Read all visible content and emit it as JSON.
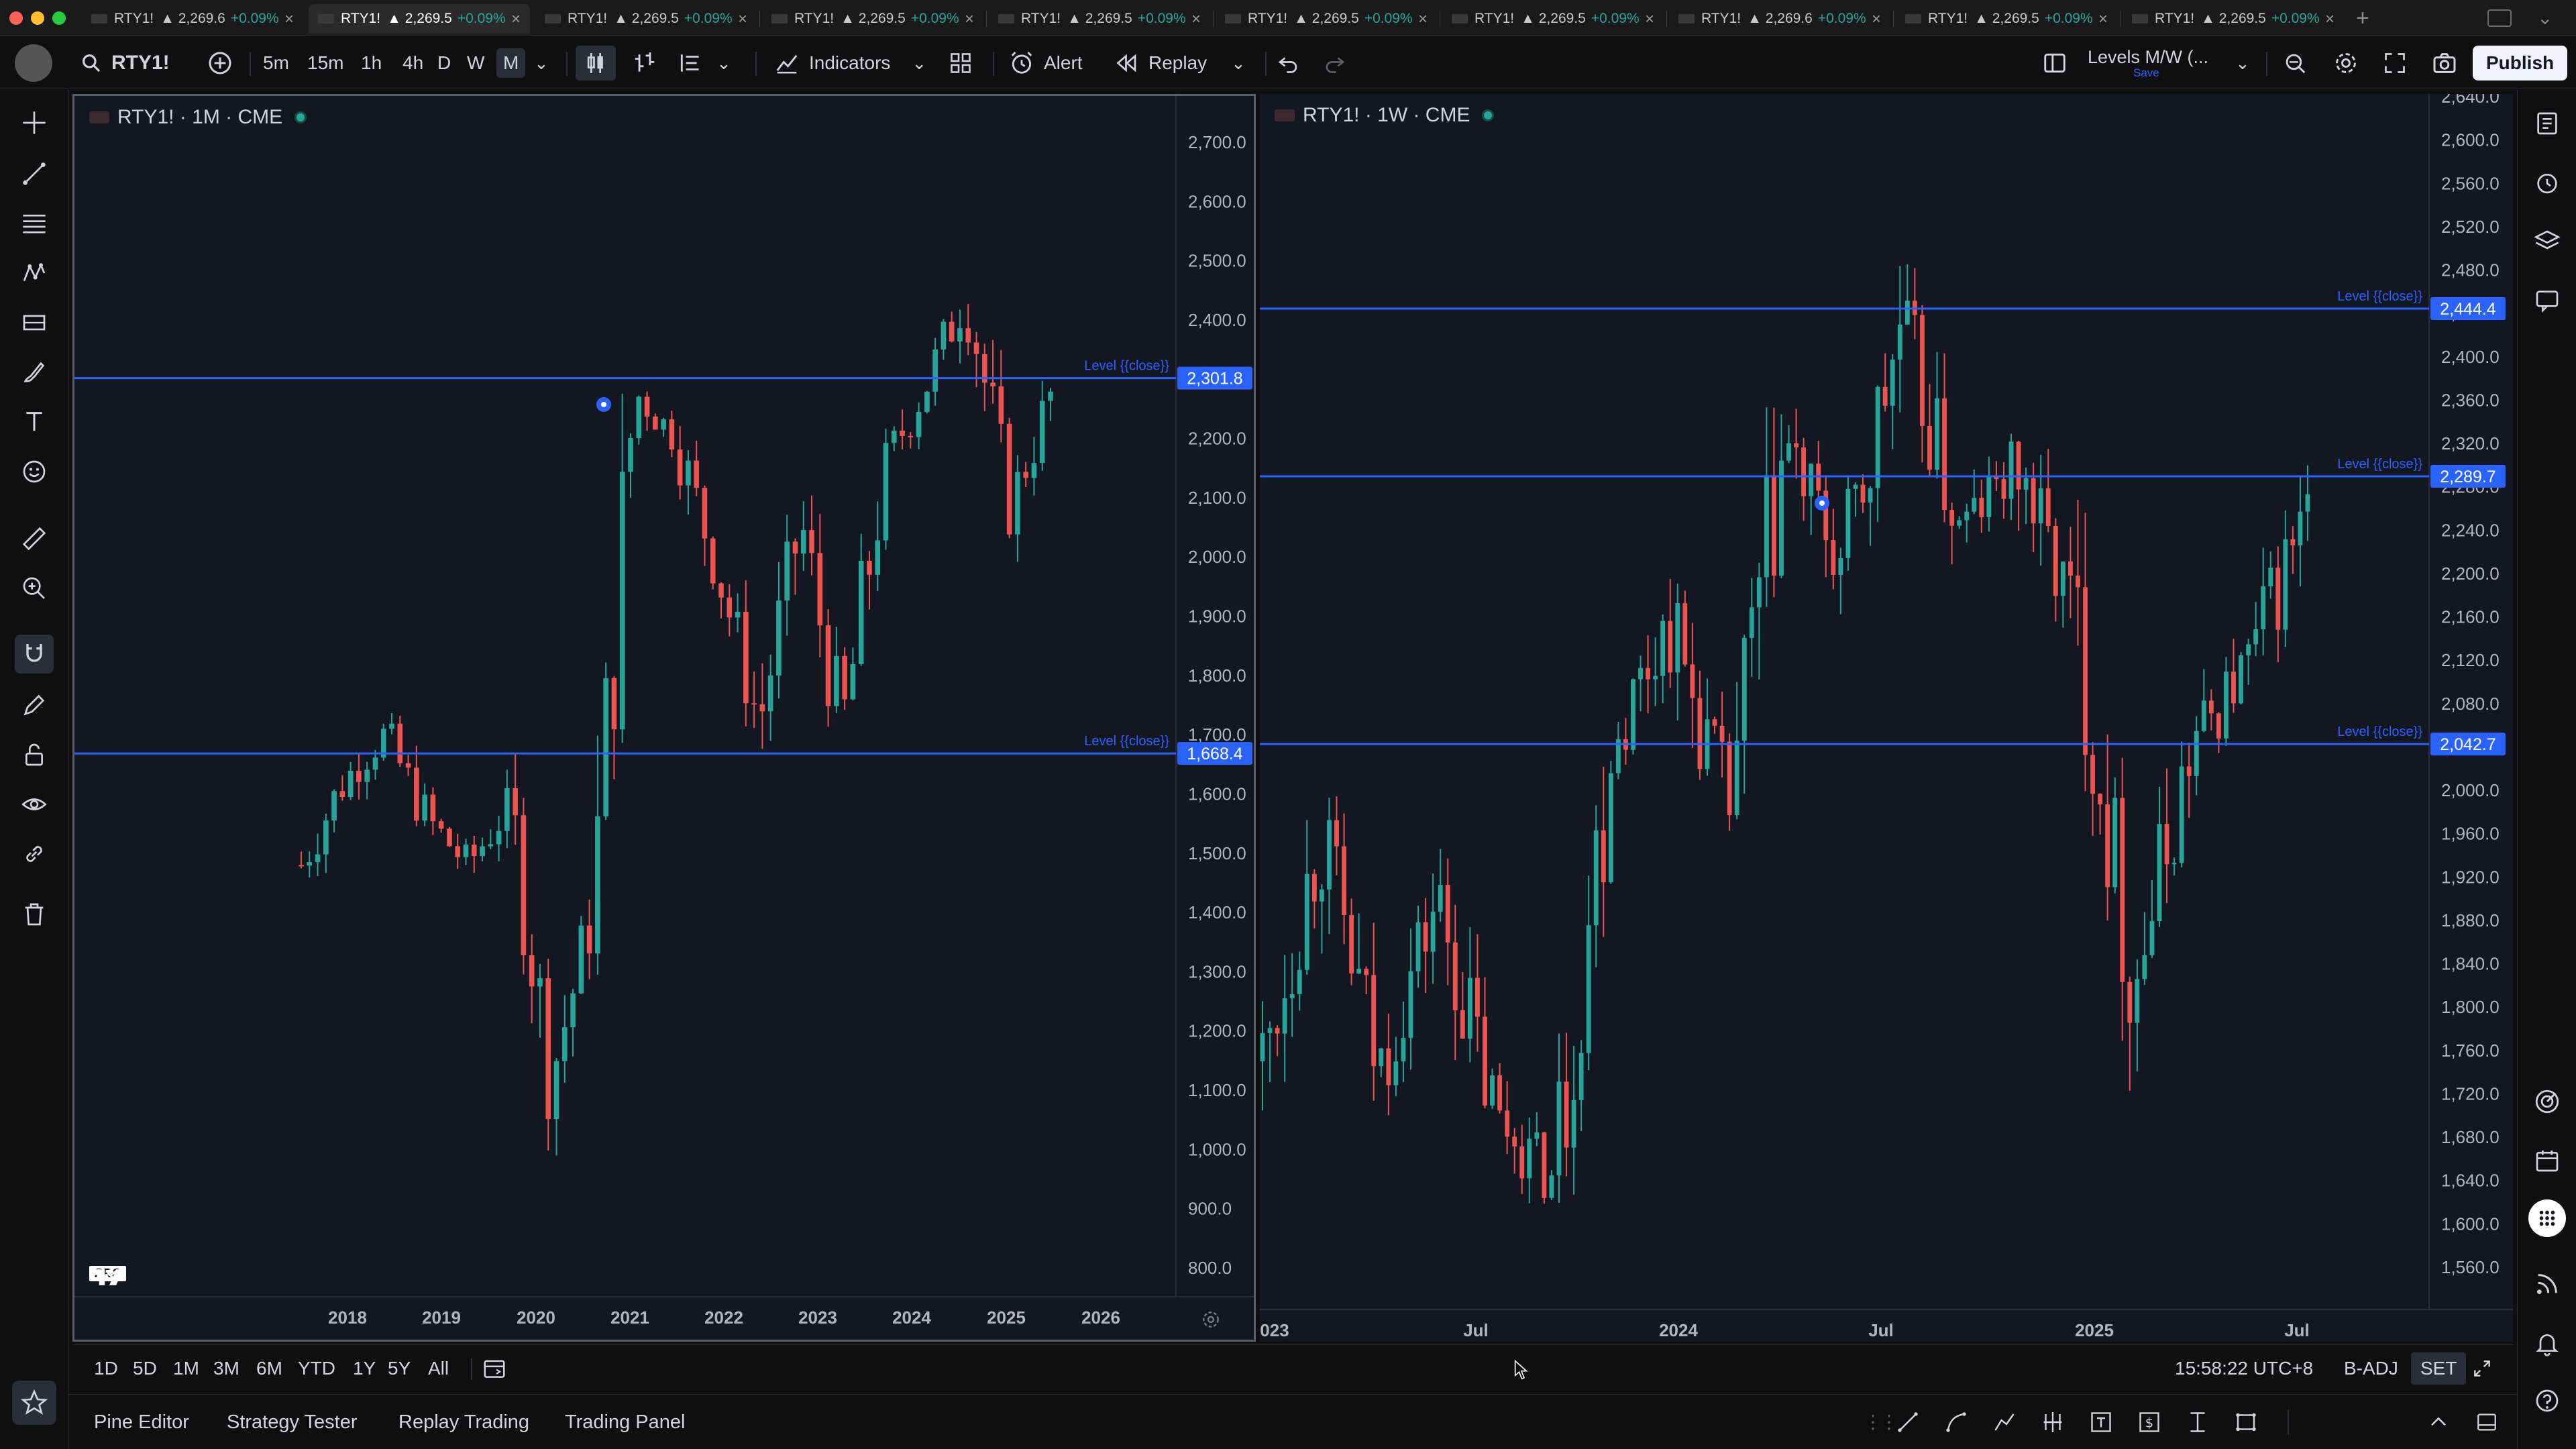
{
  "window": {
    "traffic_lights": [
      "#ff5f57",
      "#febc2e",
      "#28c840"
    ]
  },
  "tabs": [
    {
      "symbol": "RTY1!",
      "price": "▲ 2,269.6",
      "change": "+0.09%",
      "active": false
    },
    {
      "symbol": "RTY1!",
      "price": "▲ 2,269.5",
      "change": "+0.09%",
      "active": true
    },
    {
      "symbol": "RTY1!",
      "price": "▲ 2,269.5",
      "change": "+0.09%",
      "active": false
    },
    {
      "symbol": "RTY1!",
      "price": "▲ 2,269.5",
      "change": "+0.09%",
      "active": false
    },
    {
      "symbol": "RTY1!",
      "price": "▲ 2,269.5",
      "change": "+0.09%",
      "active": false
    },
    {
      "symbol": "RTY1!",
      "price": "▲ 2,269.5",
      "change": "+0.09%",
      "active": false
    },
    {
      "symbol": "RTY1!",
      "price": "▲ 2,269.5",
      "change": "+0.09%",
      "active": false
    },
    {
      "symbol": "RTY1!",
      "price": "▲ 2,269.6",
      "change": "+0.09%",
      "active": false
    },
    {
      "symbol": "RTY1!",
      "price": "▲ 2,269.5",
      "change": "+0.09%",
      "active": false
    },
    {
      "symbol": "RTY1!",
      "price": "▲ 2,269.5",
      "change": "+0.09%",
      "active": false
    }
  ],
  "toolbar": {
    "symbol": "RTY1!",
    "intervals": [
      "5m",
      "15m",
      "1h",
      "4h",
      "D",
      "W",
      "M"
    ],
    "active_interval": "M",
    "indicators_label": "Indicators",
    "alert_label": "Alert",
    "replay_label": "Replay",
    "layout_name": "Levels M/W (...",
    "layout_save": "Save",
    "publish_label": "Publish"
  },
  "colors": {
    "bg": "#131722",
    "up": "#26a69a",
    "down": "#ef5350",
    "level": "#2962ff",
    "axis_text": "#b2b5be",
    "accent": "#2962ff"
  },
  "left_chart": {
    "legend": "RTY1! · 1M · CME",
    "y_ticks": [
      "2,700.0",
      "2,600.0",
      "2,500.0",
      "2,400.0",
      "2,300.0",
      "2,200.0",
      "2,100.0",
      "2,000.0",
      "1,900.0",
      "1,800.0",
      "1,700.0",
      "1,600.0",
      "1,500.0",
      "1,400.0",
      "1,300.0",
      "1,200.0",
      "1,100.0",
      "1,000.0",
      "900.0",
      "800.0"
    ],
    "x_ticks": [
      "2018",
      "2019",
      "2020",
      "2021",
      "2022",
      "2023",
      "2024",
      "2025",
      "2026"
    ],
    "levels": [
      {
        "label": "Level {{close}}",
        "value": "2,301.8"
      },
      {
        "label": "Level {{close}}",
        "value": "1,668.4"
      }
    ],
    "watermark": "PRO"
  },
  "right_chart": {
    "legend": "RTY1! · 1W · CME",
    "y_ticks": [
      "2,640.0",
      "2,600.0",
      "2,560.0",
      "2,520.0",
      "2,480.0",
      "2,440.0",
      "2,400.0",
      "2,360.0",
      "2,320.0",
      "2,280.0",
      "2,240.0",
      "2,200.0",
      "2,160.0",
      "2,120.0",
      "2,080.0",
      "2,040.0",
      "2,000.0",
      "1,960.0",
      "1,920.0",
      "1,880.0",
      "1,840.0",
      "1,800.0",
      "1,760.0",
      "1,720.0",
      "1,680.0",
      "1,640.0",
      "1,600.0",
      "1,560.0"
    ],
    "x_ticks": [
      "023",
      "Jul",
      "2024",
      "Jul",
      "2025",
      "Jul"
    ],
    "levels": [
      {
        "label": "Level {{close}}",
        "value": "2,444.4"
      },
      {
        "label": "Level {{close}}",
        "value": "2,289.7"
      },
      {
        "label": "Level {{close}}",
        "value": "2,042.7"
      }
    ]
  },
  "rangebar": {
    "ranges": [
      "1D",
      "5D",
      "1M",
      "3M",
      "6M",
      "YTD",
      "1Y",
      "5Y",
      "All"
    ],
    "clock": "15:58:22 UTC+8",
    "adj": "B-ADJ",
    "session": "SET"
  },
  "panels": [
    "Pine Editor",
    "Strategy Tester",
    "Replay Trading",
    "Trading Panel"
  ]
}
